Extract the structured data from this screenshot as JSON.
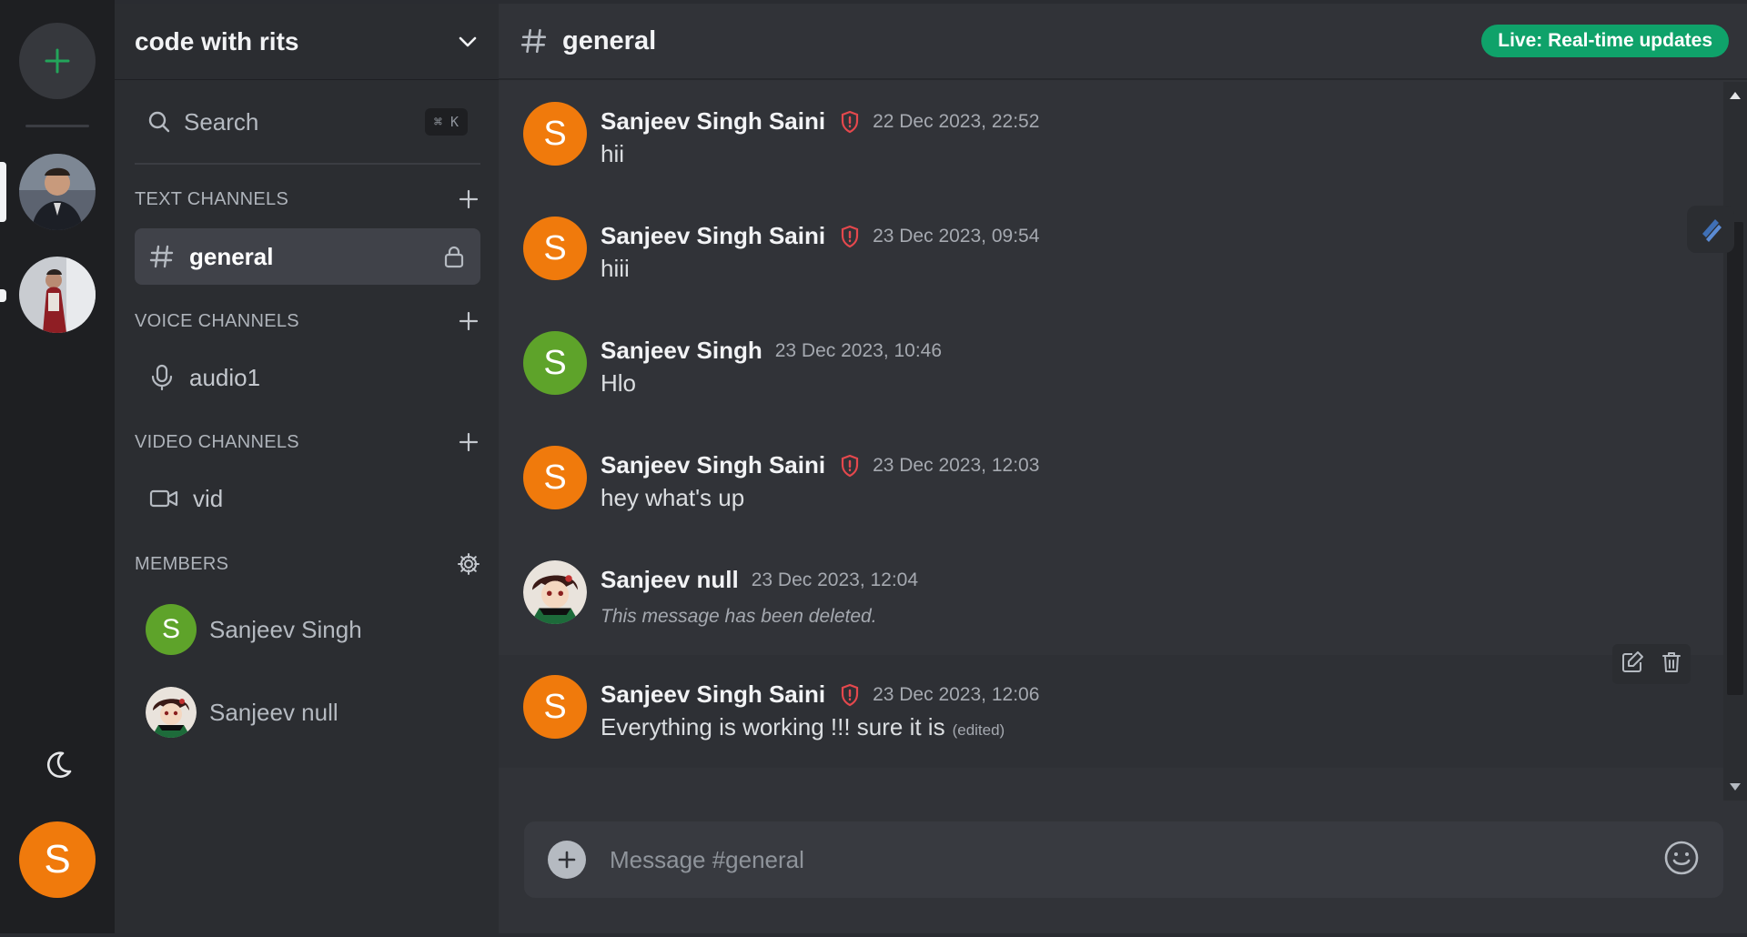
{
  "rail": {
    "add_server_icon": "plus-icon",
    "theme_toggle_icon": "moon-icon",
    "user_initial": "S",
    "accent": "#23a55a",
    "user_color": "#f07a0c"
  },
  "sidebar": {
    "server_name": "code with rits",
    "search_label": "Search",
    "search_shortcut": "⌘ K",
    "text_section": "TEXT CHANNELS",
    "voice_section": "VOICE CHANNELS",
    "video_section": "VIDEO CHANNELS",
    "members_section": "MEMBERS",
    "text_channels": [
      {
        "name": "general",
        "locked": true
      }
    ],
    "voice_channels": [
      {
        "name": "audio1"
      }
    ],
    "video_channels": [
      {
        "name": "vid"
      }
    ],
    "members": [
      {
        "name": "Sanjeev Singh",
        "initial": "S",
        "color": "#5ea32a"
      },
      {
        "name": "Sanjeev null",
        "avatar": "anime-avatar"
      }
    ]
  },
  "chat": {
    "channel": "general",
    "live_badge": "Live: Real-time updates",
    "live_color": "#0fa26a",
    "composer_placeholder": "Message #general",
    "messages": [
      {
        "author": "Sanjeev Singh Saini",
        "initial": "S",
        "color": "#f07a0c",
        "moderator": true,
        "time": "22 Dec 2023, 22:52",
        "text": "hii"
      },
      {
        "author": "Sanjeev Singh Saini",
        "initial": "S",
        "color": "#f07a0c",
        "moderator": true,
        "time": "23 Dec 2023, 09:54",
        "text": "hiii"
      },
      {
        "author": "Sanjeev Singh",
        "initial": "S",
        "color": "#5ea32a",
        "moderator": false,
        "time": "23 Dec 2023, 10:46",
        "text": "Hlo"
      },
      {
        "author": "Sanjeev Singh Saini",
        "initial": "S",
        "color": "#f07a0c",
        "moderator": true,
        "time": "23 Dec 2023, 12:03",
        "text": "hey what's up"
      },
      {
        "author": "Sanjeev null",
        "avatar": "anime-avatar",
        "moderator": false,
        "time": "23 Dec 2023, 12:04",
        "text": "This message has been deleted.",
        "deleted": true
      },
      {
        "author": "Sanjeev Singh Saini",
        "initial": "S",
        "color": "#f07a0c",
        "moderator": true,
        "time": "23 Dec 2023, 12:06",
        "text": "Everything is working !!! sure it is",
        "edited_label": "(edited)"
      }
    ]
  }
}
